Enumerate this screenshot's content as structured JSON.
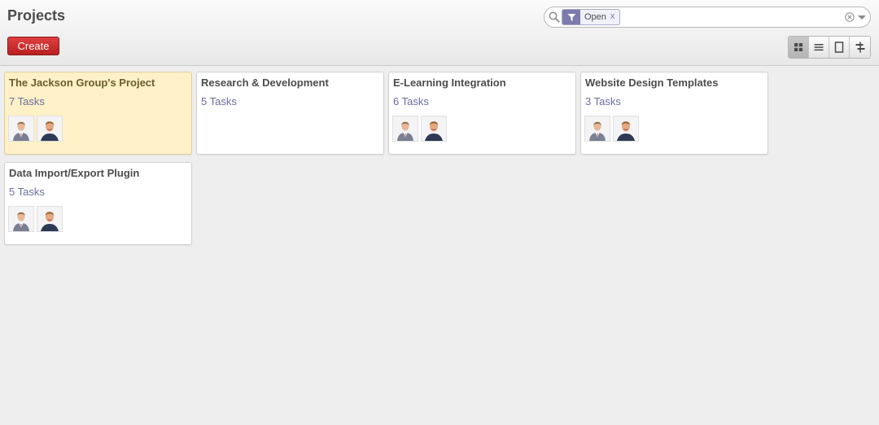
{
  "header": {
    "title": "Projects",
    "create_label": "Create"
  },
  "search": {
    "facet_icon": "filter-icon",
    "facet_value": "Open",
    "facet_remove": "x",
    "value": "",
    "placeholder": ""
  },
  "views": [
    {
      "icon": "kanban-view-icon",
      "active": true
    },
    {
      "icon": "list-view-icon",
      "active": false
    },
    {
      "icon": "form-view-icon",
      "active": false
    },
    {
      "icon": "gantt-view-icon",
      "active": false
    }
  ],
  "projects": [
    {
      "name": "The Jackson Group's Project",
      "tasks": "7 Tasks",
      "highlighted": true,
      "members": [
        "avatar-man-suit",
        "avatar-man-smiling"
      ]
    },
    {
      "name": "Research & Development",
      "tasks": "5 Tasks",
      "highlighted": false,
      "members": []
    },
    {
      "name": "E-Learning Integration",
      "tasks": "6 Tasks",
      "highlighted": false,
      "members": [
        "avatar-man-suit",
        "avatar-man-smiling"
      ]
    },
    {
      "name": "Website Design Templates",
      "tasks": "3 Tasks",
      "highlighted": false,
      "members": [
        "avatar-man-suit",
        "avatar-man-smiling"
      ]
    },
    {
      "name": "Data Import/Export Plugin",
      "tasks": "5 Tasks",
      "highlighted": false,
      "members": [
        "avatar-man-suit",
        "avatar-man-smiling"
      ]
    }
  ],
  "colors": {
    "accent_purple": "#7c7bad",
    "create_red": "#c62c2c",
    "highlight_card": "#fef0c7"
  }
}
